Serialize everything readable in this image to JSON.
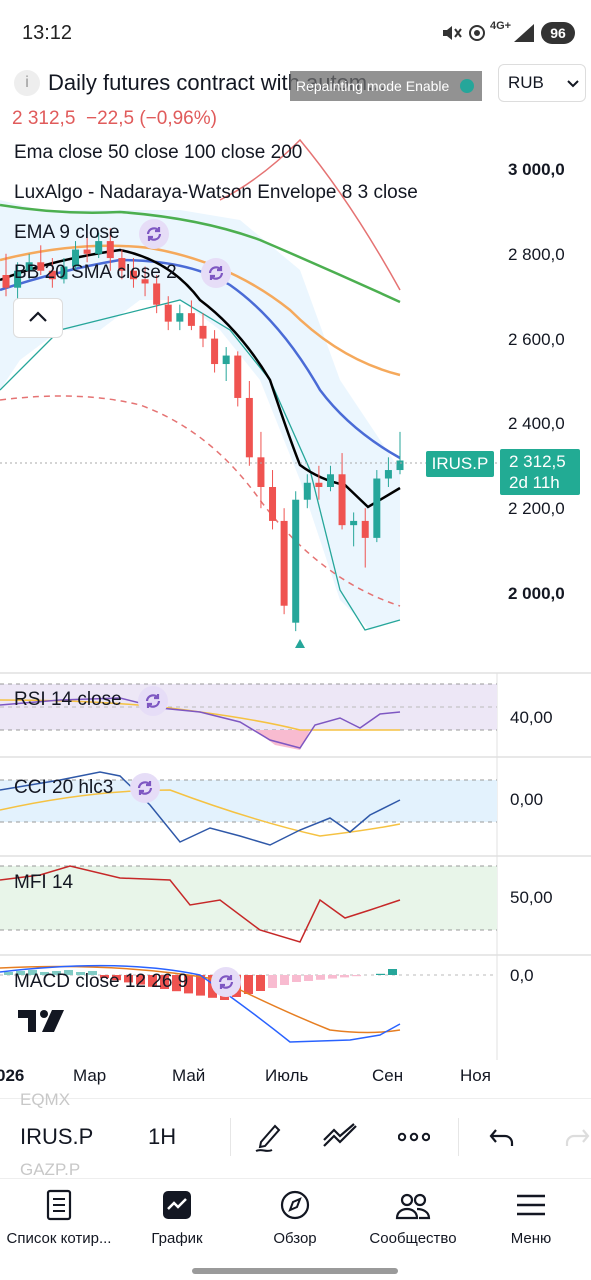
{
  "status_bar": {
    "time": "13:12",
    "network": "4G+",
    "battery": "96"
  },
  "header": {
    "title": "Daily futures contract with autom...",
    "notice": "Repainting mode Enable",
    "currency": "RUB",
    "price": "2 312,5",
    "change": "−22,5 (−0,96%)"
  },
  "indicators": {
    "ema_multi": "Ema close 50 close 100 close 200",
    "luxalgo": "LuxAlgo - Nadaraya-Watson Envelope 8 3 close",
    "ema9": "EMA 9 close",
    "bb": "BB 20 SMA close 2",
    "rsi": "RSI 14 close",
    "cci": "CCI 20 hlc3",
    "mfi": "MFI 14",
    "macd": "MACD close 12 26 9"
  },
  "price_axis": [
    "3 000,0",
    "2 800,0",
    "2 600,0",
    "2 400,0",
    "2 200,0",
    "2 000,0"
  ],
  "symbol_label": "IRUS.P",
  "last_price": "2 312,5",
  "countdown": "2d 11h",
  "rsi_value": "40,00",
  "cci_value": "0,00",
  "mfi_value": "50,00",
  "macd_value": "0,0",
  "time_axis": [
    "026",
    "Мар",
    "Май",
    "Июль",
    "Сен",
    "Ноя"
  ],
  "toolbar": {
    "prev_symbol": "EQMX",
    "symbol": "IRUS.P",
    "next_symbol": "GAZP.P",
    "interval": "1H"
  },
  "nav": [
    {
      "label": "Список котир...",
      "icon": "document-icon"
    },
    {
      "label": "График",
      "icon": "chart-icon"
    },
    {
      "label": "Обзор",
      "icon": "compass-icon"
    },
    {
      "label": "Сообщество",
      "icon": "community-icon"
    },
    {
      "label": "Меню",
      "icon": "menu-icon"
    }
  ],
  "colors": {
    "up": "#26a69a",
    "down": "#ef5350",
    "price_label": "#22ab94",
    "ema9": "#000000",
    "ema50": "#4a6bd6",
    "ema100": "#f5a95c",
    "ema200": "#4caf50",
    "envelope": "#e57373",
    "rsi": "#7e57c2"
  },
  "chart_data": {
    "type": "candlestick",
    "ylim": [
      1900,
      3100
    ],
    "candles": [
      {
        "o": 2750,
        "h": 2800,
        "l": 2700,
        "c": 2720
      },
      {
        "o": 2720,
        "h": 2780,
        "l": 2690,
        "c": 2760
      },
      {
        "o": 2760,
        "h": 2800,
        "l": 2740,
        "c": 2780
      },
      {
        "o": 2780,
        "h": 2820,
        "l": 2750,
        "c": 2760
      },
      {
        "o": 2760,
        "h": 2790,
        "l": 2720,
        "c": 2740
      },
      {
        "o": 2740,
        "h": 2790,
        "l": 2730,
        "c": 2770
      },
      {
        "o": 2770,
        "h": 2830,
        "l": 2760,
        "c": 2810
      },
      {
        "o": 2810,
        "h": 2840,
        "l": 2780,
        "c": 2800
      },
      {
        "o": 2800,
        "h": 2850,
        "l": 2790,
        "c": 2830
      },
      {
        "o": 2830,
        "h": 2860,
        "l": 2760,
        "c": 2790
      },
      {
        "o": 2790,
        "h": 2810,
        "l": 2740,
        "c": 2760
      },
      {
        "o": 2760,
        "h": 2790,
        "l": 2720,
        "c": 2740
      },
      {
        "o": 2740,
        "h": 2770,
        "l": 2700,
        "c": 2730
      },
      {
        "o": 2730,
        "h": 2750,
        "l": 2660,
        "c": 2680
      },
      {
        "o": 2680,
        "h": 2700,
        "l": 2620,
        "c": 2640
      },
      {
        "o": 2640,
        "h": 2680,
        "l": 2620,
        "c": 2660
      },
      {
        "o": 2660,
        "h": 2690,
        "l": 2620,
        "c": 2630
      },
      {
        "o": 2630,
        "h": 2660,
        "l": 2580,
        "c": 2600
      },
      {
        "o": 2600,
        "h": 2620,
        "l": 2520,
        "c": 2540
      },
      {
        "o": 2540,
        "h": 2580,
        "l": 2500,
        "c": 2560
      },
      {
        "o": 2560,
        "h": 2570,
        "l": 2440,
        "c": 2460
      },
      {
        "o": 2460,
        "h": 2500,
        "l": 2300,
        "c": 2320
      },
      {
        "o": 2320,
        "h": 2380,
        "l": 2200,
        "c": 2250
      },
      {
        "o": 2250,
        "h": 2290,
        "l": 2150,
        "c": 2170
      },
      {
        "o": 2170,
        "h": 2200,
        "l": 1950,
        "c": 1970
      },
      {
        "o": 1930,
        "h": 2240,
        "l": 1910,
        "c": 2220
      },
      {
        "o": 2220,
        "h": 2280,
        "l": 2200,
        "c": 2260
      },
      {
        "o": 2260,
        "h": 2300,
        "l": 2220,
        "c": 2250
      },
      {
        "o": 2250,
        "h": 2300,
        "l": 2240,
        "c": 2280
      },
      {
        "o": 2280,
        "h": 2330,
        "l": 2150,
        "c": 2160
      },
      {
        "o": 2160,
        "h": 2190,
        "l": 2110,
        "c": 2170
      },
      {
        "o": 2170,
        "h": 2200,
        "l": 2060,
        "c": 2130
      },
      {
        "o": 2130,
        "h": 2290,
        "l": 2120,
        "c": 2270
      },
      {
        "o": 2270,
        "h": 2320,
        "l": 2250,
        "c": 2290
      },
      {
        "o": 2290,
        "h": 2380,
        "l": 2280,
        "c": 2312.5
      }
    ]
  }
}
